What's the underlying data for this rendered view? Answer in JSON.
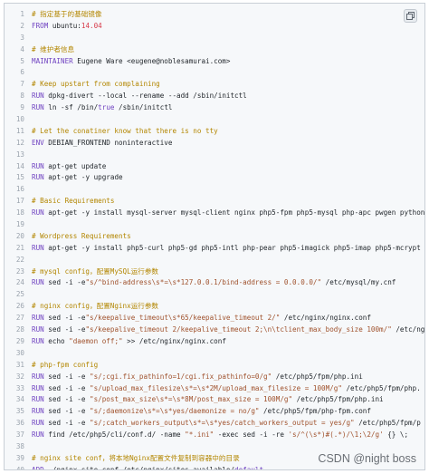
{
  "watermark": "CSDN @night boss",
  "copy_icon": "copy-icon",
  "lines": [
    {
      "n": "1",
      "p": [
        {
          "t": "# 指定基于的基础镜像",
          "c": "c"
        }
      ]
    },
    {
      "n": "2",
      "p": [
        {
          "t": "FROM ",
          "c": "k"
        },
        {
          "t": "ubuntu:",
          "c": ""
        },
        {
          "t": "14.04",
          "c": "n"
        }
      ]
    },
    {
      "n": "3",
      "p": []
    },
    {
      "n": "4",
      "p": [
        {
          "t": "# 维护者信息",
          "c": "c"
        }
      ]
    },
    {
      "n": "5",
      "p": [
        {
          "t": "MAINTAINER ",
          "c": "k"
        },
        {
          "t": "Eugene Ware <eugene@noblesamurai.com>",
          "c": ""
        }
      ]
    },
    {
      "n": "6",
      "p": []
    },
    {
      "n": "7",
      "p": [
        {
          "t": "# Keep upstart from complaining",
          "c": "c"
        }
      ]
    },
    {
      "n": "8",
      "p": [
        {
          "t": "RUN ",
          "c": "k"
        },
        {
          "t": "dpkg-divert --local --rename --add /sbin/initctl",
          "c": ""
        }
      ]
    },
    {
      "n": "9",
      "p": [
        {
          "t": "RUN ",
          "c": "k"
        },
        {
          "t": "ln -sf /bin/",
          "c": ""
        },
        {
          "t": "true",
          "c": "k"
        },
        {
          "t": " /sbin/initctl",
          "c": ""
        }
      ]
    },
    {
      "n": "10",
      "p": []
    },
    {
      "n": "11",
      "p": [
        {
          "t": "# Let the conatiner know that there is no tty",
          "c": "c"
        }
      ]
    },
    {
      "n": "12",
      "p": [
        {
          "t": "ENV ",
          "c": "k"
        },
        {
          "t": "DEBIAN_FRONTEND noninteractive",
          "c": ""
        }
      ]
    },
    {
      "n": "13",
      "p": []
    },
    {
      "n": "14",
      "p": [
        {
          "t": "RUN ",
          "c": "k"
        },
        {
          "t": "apt-get update",
          "c": ""
        }
      ]
    },
    {
      "n": "15",
      "p": [
        {
          "t": "RUN ",
          "c": "k"
        },
        {
          "t": "apt-get -y upgrade",
          "c": ""
        }
      ]
    },
    {
      "n": "16",
      "p": []
    },
    {
      "n": "17",
      "p": [
        {
          "t": "# Basic Requirements",
          "c": "c"
        }
      ]
    },
    {
      "n": "18",
      "p": [
        {
          "t": "RUN ",
          "c": "k"
        },
        {
          "t": "apt-get -y install mysql-server mysql-client nginx php5-fpm php5-mysql php-apc pwgen python",
          "c": ""
        }
      ]
    },
    {
      "n": "19",
      "p": []
    },
    {
      "n": "20",
      "p": [
        {
          "t": "# Wordpress Requirements",
          "c": "c"
        }
      ]
    },
    {
      "n": "21",
      "p": [
        {
          "t": "RUN ",
          "c": "k"
        },
        {
          "t": "apt-get -y install php5-curl php5-gd php5-intl php-pear php5-imagick php5-imap php5-mcrypt",
          "c": ""
        }
      ]
    },
    {
      "n": "22",
      "p": []
    },
    {
      "n": "23",
      "p": [
        {
          "t": "# mysql config，配置MySQL运行参数",
          "c": "c"
        }
      ]
    },
    {
      "n": "24",
      "p": [
        {
          "t": "RUN ",
          "c": "k"
        },
        {
          "t": "sed -i -e",
          "c": ""
        },
        {
          "t": "\"s/^bind-address\\s*=\\s*127.0.0.1/bind-address = 0.0.0.0/\"",
          "c": "s"
        },
        {
          "t": " /etc/mysql/my.cnf",
          "c": ""
        }
      ]
    },
    {
      "n": "25",
      "p": []
    },
    {
      "n": "26",
      "p": [
        {
          "t": "# nginx config，配置Nginx运行参数",
          "c": "c"
        }
      ]
    },
    {
      "n": "27",
      "p": [
        {
          "t": "RUN ",
          "c": "k"
        },
        {
          "t": "sed -i -e",
          "c": ""
        },
        {
          "t": "\"s/keepalive_timeout\\s*65/keepalive_timeout 2/\"",
          "c": "s"
        },
        {
          "t": " /etc/nginx/nginx.conf",
          "c": ""
        }
      ]
    },
    {
      "n": "28",
      "p": [
        {
          "t": "RUN ",
          "c": "k"
        },
        {
          "t": "sed -i -e",
          "c": ""
        },
        {
          "t": "\"s/keepalive_timeout 2/keepalive_timeout 2;\\n\\tclient_max_body_size 100m/\"",
          "c": "s"
        },
        {
          "t": " /etc/nginx",
          "c": ""
        }
      ]
    },
    {
      "n": "29",
      "p": [
        {
          "t": "RUN ",
          "c": "k"
        },
        {
          "t": "echo ",
          "c": ""
        },
        {
          "t": "\"daemon off;\"",
          "c": "s"
        },
        {
          "t": " >> /etc/nginx/nginx.conf",
          "c": ""
        }
      ]
    },
    {
      "n": "30",
      "p": []
    },
    {
      "n": "31",
      "p": [
        {
          "t": "# php-fpm config",
          "c": "c"
        }
      ]
    },
    {
      "n": "32",
      "p": [
        {
          "t": "RUN ",
          "c": "k"
        },
        {
          "t": "sed -i -e ",
          "c": ""
        },
        {
          "t": "\"s/;cgi.fix_pathinfo=1/cgi.fix_pathinfo=0/g\"",
          "c": "s"
        },
        {
          "t": " /etc/php5/fpm/php.ini",
          "c": ""
        }
      ]
    },
    {
      "n": "33",
      "p": [
        {
          "t": "RUN ",
          "c": "k"
        },
        {
          "t": "sed -i -e ",
          "c": ""
        },
        {
          "t": "\"s/upload_max_filesize\\s*=\\s*2M/upload_max_filesize = 100M/g\"",
          "c": "s"
        },
        {
          "t": " /etc/php5/fpm/php.",
          "c": ""
        }
      ]
    },
    {
      "n": "34",
      "p": [
        {
          "t": "RUN ",
          "c": "k"
        },
        {
          "t": "sed -i -e ",
          "c": ""
        },
        {
          "t": "\"s/post_max_size\\s*=\\s*8M/post_max_size = 100M/g\"",
          "c": "s"
        },
        {
          "t": " /etc/php5/fpm/php.ini",
          "c": ""
        }
      ]
    },
    {
      "n": "35",
      "p": [
        {
          "t": "RUN ",
          "c": "k"
        },
        {
          "t": "sed -i -e ",
          "c": ""
        },
        {
          "t": "\"s/;daemonize\\s*=\\s*yes/daemonize = no/g\"",
          "c": "s"
        },
        {
          "t": " /etc/php5/fpm/php-fpm.conf",
          "c": ""
        }
      ]
    },
    {
      "n": "36",
      "p": [
        {
          "t": "RUN ",
          "c": "k"
        },
        {
          "t": "sed -i -e ",
          "c": ""
        },
        {
          "t": "\"s/;catch_workers_output\\s*=\\s*yes/catch_workers_output = yes/g\"",
          "c": "s"
        },
        {
          "t": " /etc/php5/fpm/p",
          "c": ""
        }
      ]
    },
    {
      "n": "37",
      "p": [
        {
          "t": "RUN ",
          "c": "k"
        },
        {
          "t": "find /etc/php5/cli/conf.d/ -name ",
          "c": ""
        },
        {
          "t": "\"*.ini\"",
          "c": "s"
        },
        {
          "t": " -exec sed -i -re ",
          "c": ""
        },
        {
          "t": "'s/^(\\s*)#(.*)/\\1;\\2/g'",
          "c": "s"
        },
        {
          "t": " {} \\;",
          "c": ""
        }
      ]
    },
    {
      "n": "38",
      "p": []
    },
    {
      "n": "39",
      "p": [
        {
          "t": "# nginx site conf，将本地Nginx配置文件复制到容器中的目录",
          "c": "c"
        }
      ]
    },
    {
      "n": "40",
      "p": [
        {
          "t": "ADD ",
          "c": "k"
        },
        {
          "t": "./nginx-site.conf /etc/nginx/sites-available/",
          "c": ""
        },
        {
          "t": "default",
          "c": "k"
        }
      ]
    }
  ]
}
